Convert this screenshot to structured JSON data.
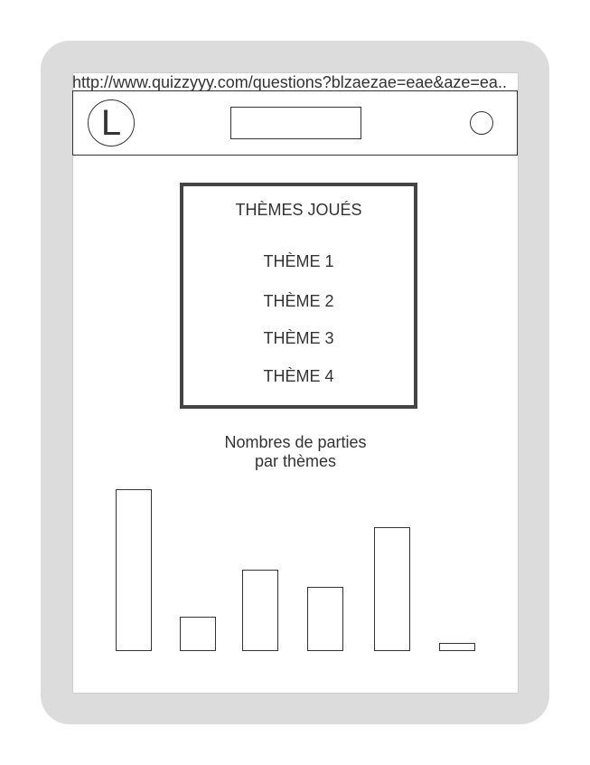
{
  "browser": {
    "url": "http://www.quizzyyy.com/questions?blzaezae=eae&aze=ea.."
  },
  "header": {
    "logo_letter": "L"
  },
  "themes": {
    "title": "THÈMES JOUÉS",
    "items": [
      "THÈME 1",
      "THÈME 2",
      "THÈME 3",
      "THÈME 4"
    ]
  },
  "chart_title_line1": "Nombres de parties",
  "chart_title_line2": "par thèmes",
  "chart_data": {
    "type": "bar",
    "title": "Nombres de parties par thèmes",
    "categories": [
      "",
      "",
      "",
      "",
      "",
      ""
    ],
    "values": [
      178,
      38,
      89,
      71,
      136,
      9
    ],
    "ylim": [
      0,
      178
    ],
    "grid": false
  }
}
